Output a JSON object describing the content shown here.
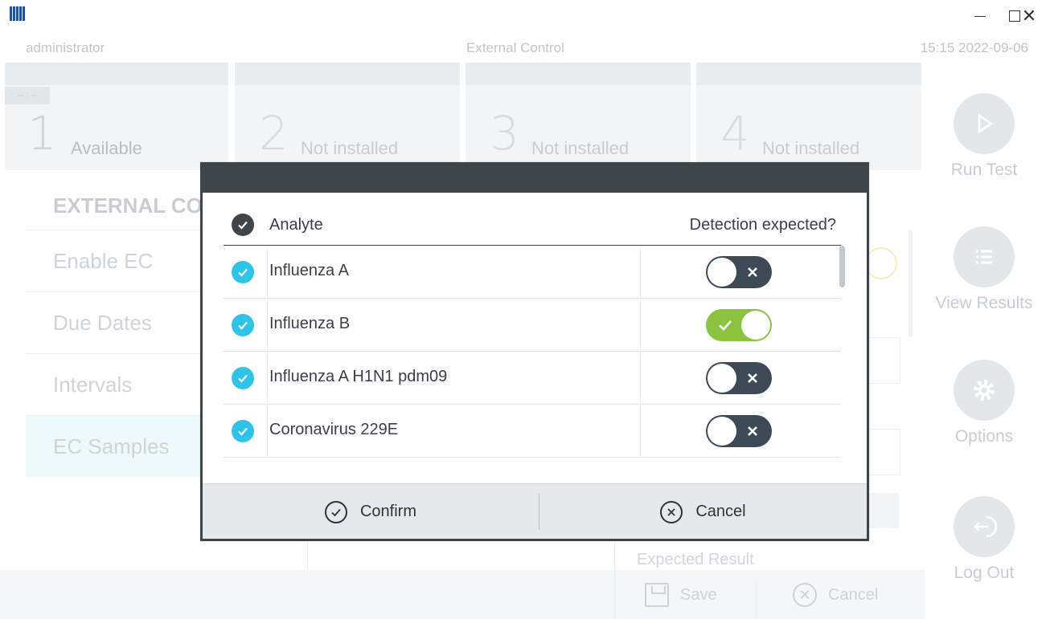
{
  "window": {
    "app_icon": "qiagen-logo-icon",
    "controls": [
      "minimize-icon",
      "maximize-icon",
      "close-icon"
    ]
  },
  "topbar": {
    "user": "administrator",
    "screen_title": "External Control",
    "datetime": "15:15 2022-09-06"
  },
  "modules": [
    {
      "number": "1",
      "status": "Available",
      "tag": "-- : --"
    },
    {
      "number": "2",
      "status": "Not installed"
    },
    {
      "number": "3",
      "status": "Not installed"
    },
    {
      "number": "4",
      "status": "Not installed"
    }
  ],
  "sidebar": {
    "items": [
      {
        "label": "Run Test",
        "icon": "play-icon"
      },
      {
        "label": "View Results",
        "icon": "list-icon"
      },
      {
        "label": "Options",
        "icon": "gear-icon"
      },
      {
        "label": "Log Out",
        "icon": "logout-icon"
      }
    ]
  },
  "ec_menu": {
    "header": "EXTERNAL CO",
    "items": [
      "Enable EC",
      "Due Dates",
      "Intervals",
      "EC Samples"
    ],
    "selected": "EC Samples"
  },
  "background_form": {
    "expected_result_label": "Expected Result",
    "save_label": "Save",
    "cancel_label": "Cancel"
  },
  "dialog": {
    "columns": {
      "analyte": "Analyte",
      "detection": "Detection expected?"
    },
    "rows": [
      {
        "analyte": "Influenza A",
        "checked": true,
        "detection_expected": false
      },
      {
        "analyte": "Influenza B",
        "checked": true,
        "detection_expected": true
      },
      {
        "analyte": "Influenza A H1N1 pdm09",
        "checked": true,
        "detection_expected": false
      },
      {
        "analyte": "Coronavirus 229E",
        "checked": true,
        "detection_expected": false
      }
    ],
    "confirm_label": "Confirm",
    "cancel_label": "Cancel"
  },
  "colors": {
    "check_accent": "#2ec4ea",
    "toggle_on": "#8cc33e",
    "toggle_off": "#3d4a56",
    "dialog_header": "#404549",
    "footer_bg": "#e6e9ec"
  }
}
